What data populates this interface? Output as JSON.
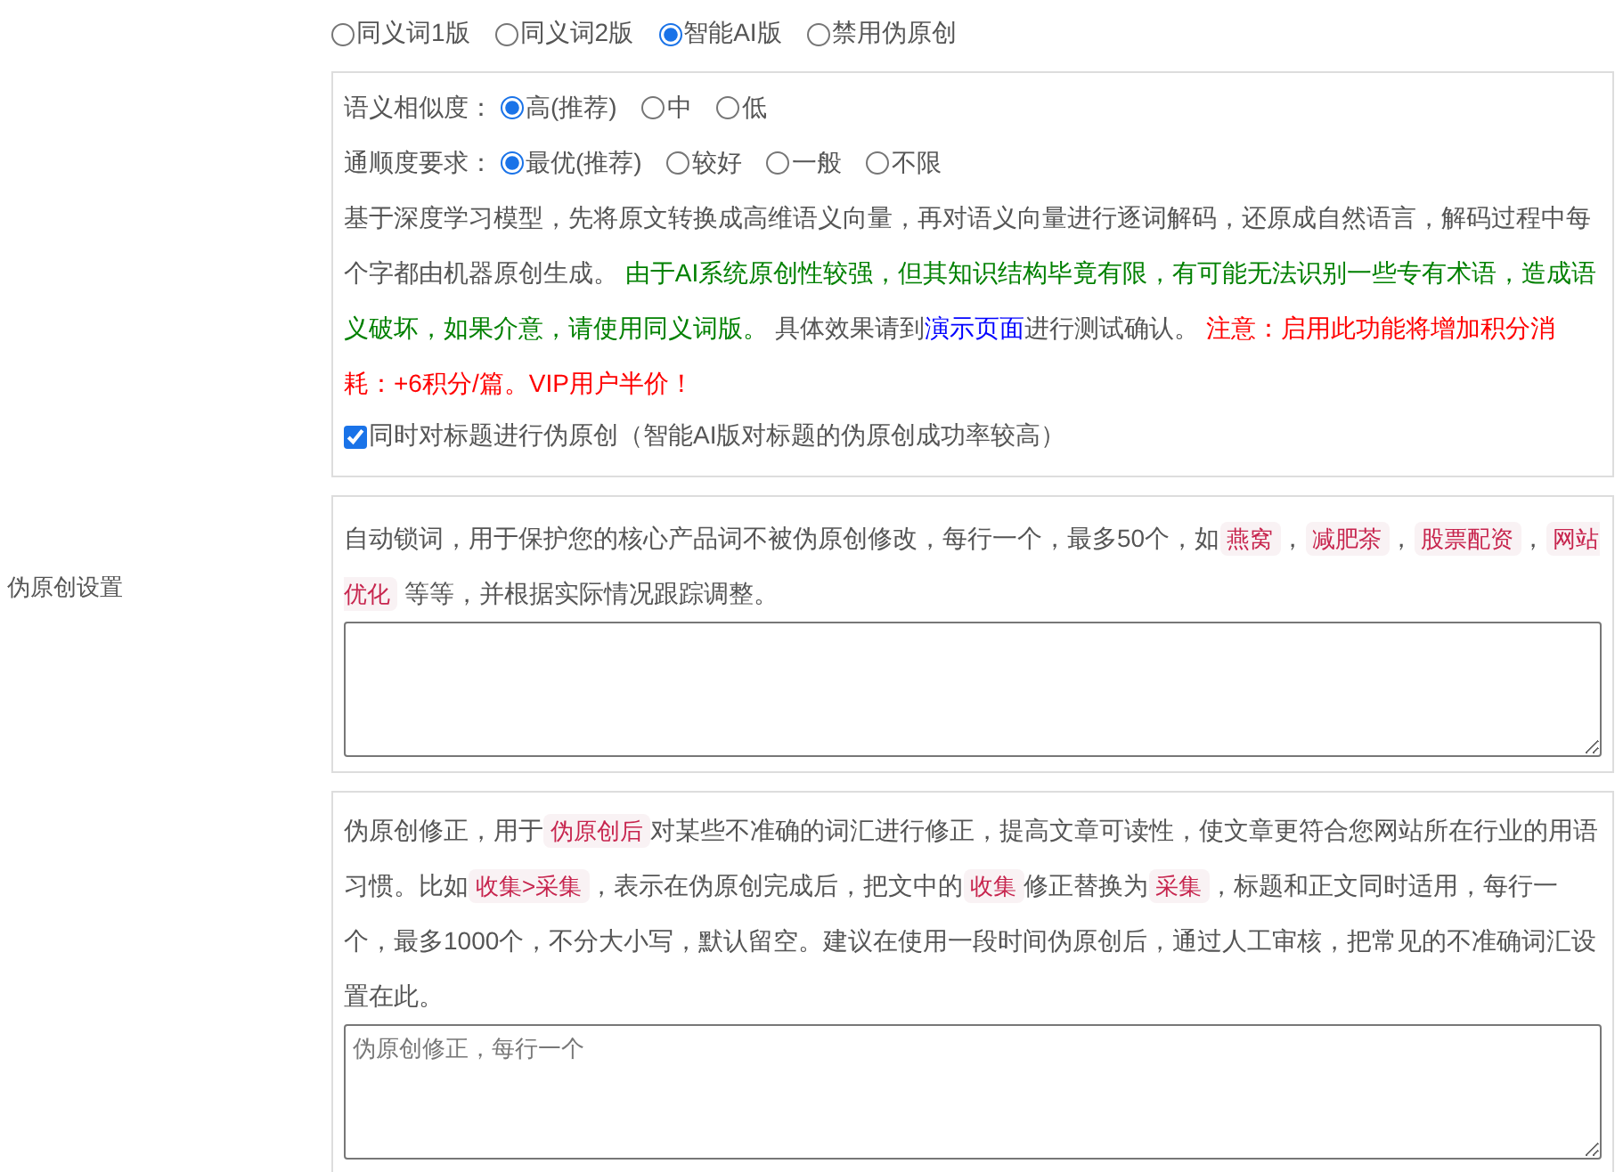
{
  "sidebar_label": "伪原创设置",
  "mode_options": [
    {
      "label": "同义词1版",
      "selected": false
    },
    {
      "label": "同义词2版",
      "selected": false
    },
    {
      "label": "智能AI版",
      "selected": true
    },
    {
      "label": "禁用伪原创",
      "selected": false
    }
  ],
  "similarity": {
    "label": "语义相似度：",
    "options": [
      {
        "label": "高(推荐)",
        "selected": true
      },
      {
        "label": "中",
        "selected": false
      },
      {
        "label": "低",
        "selected": false
      }
    ]
  },
  "fluency": {
    "label": "通顺度要求：",
    "options": [
      {
        "label": "最优(推荐)",
        "selected": true
      },
      {
        "label": "较好",
        "selected": false
      },
      {
        "label": "一般",
        "selected": false
      },
      {
        "label": "不限",
        "selected": false
      }
    ]
  },
  "ai_description": [
    {
      "kind": "text",
      "text": "基于深度学习模型，先将原文转换成高维语义向量，再对语义向量进行逐词解码，还原成自然语言，解码过程中每个字都由机器原创生成。 "
    },
    {
      "kind": "note",
      "text": "由于AI系统原创性较强，但其知识结构毕竟有限，有可能无法识别一些专有术语，造成语义破坏，如果介意，请使用同义词版。"
    },
    {
      "kind": "text",
      "text": " 具体效果请到"
    },
    {
      "kind": "link",
      "text": "演示页面"
    },
    {
      "kind": "text",
      "text": "进行测试确认。 "
    },
    {
      "kind": "warning",
      "text": "注意：启用此功能将增加积分消耗：+6积分/篇。VIP用户半价！"
    }
  ],
  "title_option": {
    "label": "同时对标题进行伪原创（智能AI版对标题的伪原创成功率较高）",
    "checked": true
  },
  "lock_words": {
    "description": [
      {
        "kind": "text",
        "text": "自动锁词，用于保护您的核心产品词不被伪原创修改，每行一个，最多50个，如"
      },
      {
        "kind": "code",
        "text": "燕窝"
      },
      {
        "kind": "text",
        "text": "，"
      },
      {
        "kind": "code",
        "text": "减肥茶"
      },
      {
        "kind": "text",
        "text": "，"
      },
      {
        "kind": "code",
        "text": "股票配资"
      },
      {
        "kind": "text",
        "text": "，"
      },
      {
        "kind": "code",
        "text": "网站优化"
      },
      {
        "kind": "text",
        "text": " 等等，并根据实际情况跟踪调整。"
      }
    ]
  },
  "corrections": {
    "description": [
      {
        "kind": "text",
        "text": "伪原创修正，用于"
      },
      {
        "kind": "code",
        "text": "伪原创后"
      },
      {
        "kind": "text",
        "text": "对某些不准确的词汇进行修正，提高文章可读性，使文章更符合您网站所在行业的用语习惯。比如"
      },
      {
        "kind": "code",
        "text": "收集>采集"
      },
      {
        "kind": "text",
        "text": "，表示在伪原创完成后，把文中的"
      },
      {
        "kind": "code",
        "text": "收集"
      },
      {
        "kind": "text",
        "text": "修正替换为"
      },
      {
        "kind": "code",
        "text": "采集"
      },
      {
        "kind": "text",
        "text": "，标题和正文同时适用，每行一个，最多1000个，不分大小写，默认留空。建议在使用一段时间伪原创后，通过人工审核，把常见的不准确词汇设置在此。"
      }
    ],
    "placeholder": "伪原创修正，每行一个"
  }
}
